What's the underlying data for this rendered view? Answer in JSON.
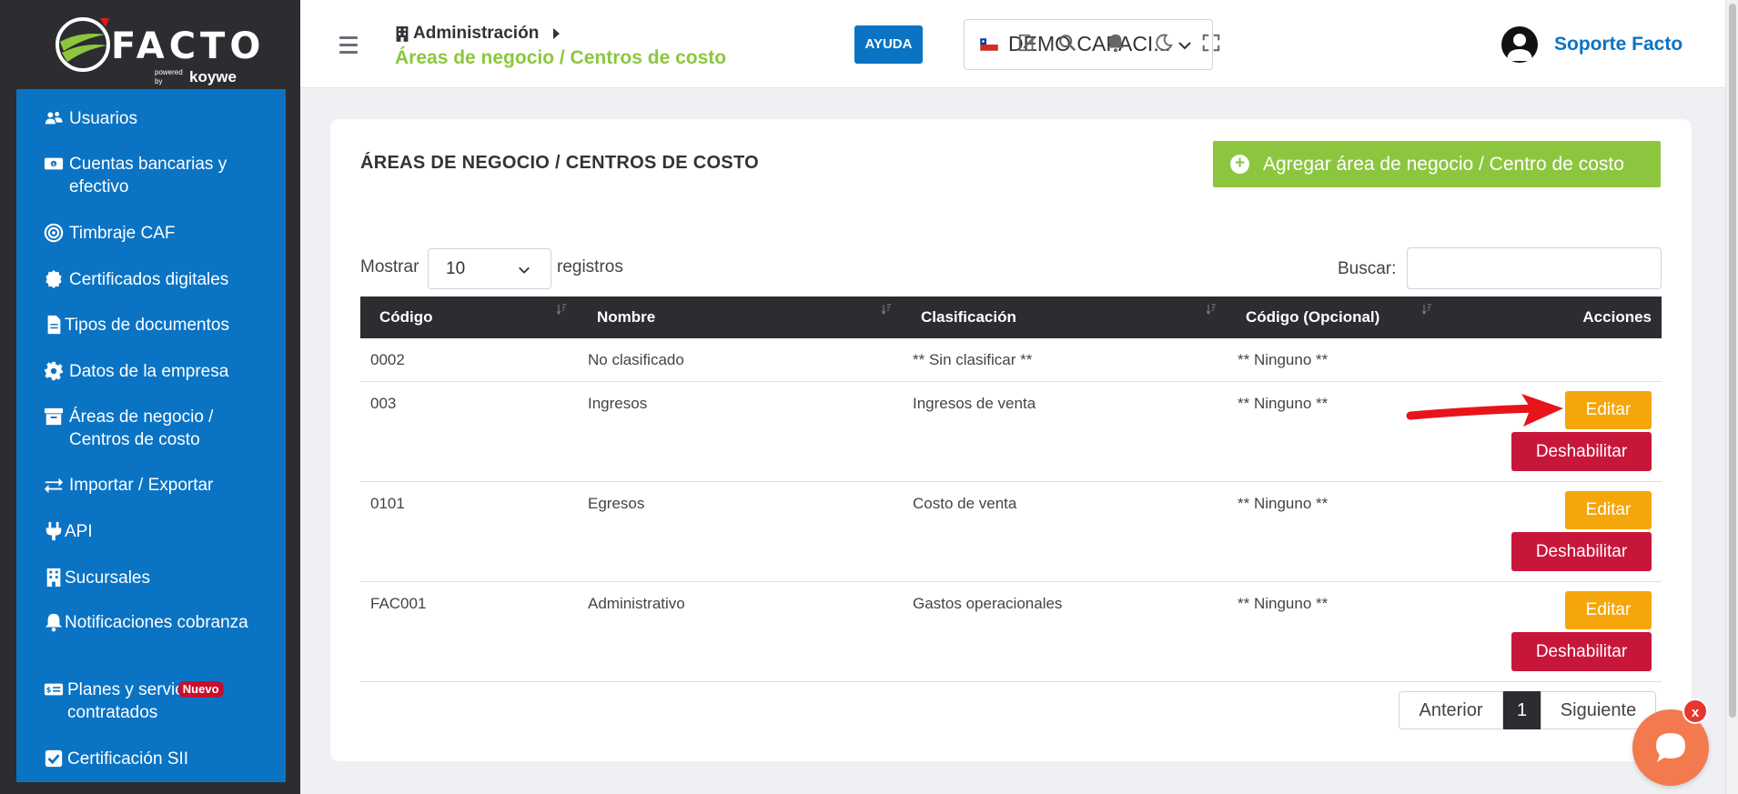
{
  "brand": {
    "logo_text": "FACTO",
    "powered": "powered by",
    "koywe": "koywe"
  },
  "sidebar": {
    "items": [
      {
        "label": "Usuarios",
        "icon": "users-icon"
      },
      {
        "label": "Cuentas bancarias y efectivo",
        "icon": "money-icon"
      },
      {
        "label": "Timbraje CAF",
        "icon": "target-icon"
      },
      {
        "label": "Certificados digitales",
        "icon": "certificate-icon"
      },
      {
        "label": "Tipos de documentos",
        "icon": "document-icon"
      },
      {
        "label": "Datos de la empresa",
        "icon": "gear-icon"
      },
      {
        "label": "Áreas de negocio / Centros de costo",
        "icon": "archive-icon"
      },
      {
        "label": "Importar / Exportar",
        "icon": "exchange-icon"
      },
      {
        "label": "API",
        "icon": "plug-icon"
      },
      {
        "label": "Sucursales",
        "icon": "building-icon"
      },
      {
        "label": "Notificaciones cobranza",
        "icon": "bell-icon"
      },
      {
        "label": "Planes y servicios contratados",
        "label_visible": "Planes y servic",
        "label_line2": "contratados",
        "icon": "plan-icon",
        "badge": "Nuevo"
      },
      {
        "label": "Certificación SII",
        "icon": "checkbox-icon"
      }
    ]
  },
  "header": {
    "breadcrumb_parent": "Administración",
    "breadcrumb_current": "Áreas de negocio / Centros de costo",
    "help_label": "AYUDA",
    "company_selected": "DEMO CAPACI...",
    "user_name": "Soporte Facto"
  },
  "main": {
    "title": "ÁREAS DE NEGOCIO / CENTROS DE COSTO",
    "add_button": "Agregar área de negocio / Centro de costo",
    "show_label": "Mostrar",
    "page_length": "10",
    "records_label": "registros",
    "search_label": "Buscar:",
    "search_value": "",
    "table": {
      "columns": [
        "Código",
        "Nombre",
        "Clasificación",
        "Código (Opcional)",
        "Acciones"
      ],
      "rows": [
        {
          "codigo": "0002",
          "nombre": "No clasificado",
          "clasificacion": "** Sin clasificar **",
          "codigo_opcional": "** Ninguno **",
          "actions": false
        },
        {
          "codigo": "003",
          "nombre": "Ingresos",
          "clasificacion": "Ingresos de venta",
          "codigo_opcional": "** Ninguno **",
          "actions": true
        },
        {
          "codigo": "0101",
          "nombre": "Egresos",
          "clasificacion": "Costo de venta",
          "codigo_opcional": "** Ninguno **",
          "actions": true
        },
        {
          "codigo": "FAC001",
          "nombre": "Administrativo",
          "clasificacion": "Gastos operacionales",
          "codigo_opcional": "** Ninguno **",
          "actions": true
        }
      ],
      "edit_label": "Editar",
      "disable_label": "Deshabilitar"
    },
    "pagination": {
      "prev": "Anterior",
      "current": "1",
      "next": "Siguiente"
    }
  },
  "chat": {
    "close_label": "x"
  },
  "colors": {
    "sidebar_blue": "#0a73c4",
    "brand_green": "#8cc63f",
    "edit_orange": "#f5a60b",
    "disable_red": "#c8163a",
    "dark": "#2b2d30",
    "annotation_red": "#e8141b"
  }
}
